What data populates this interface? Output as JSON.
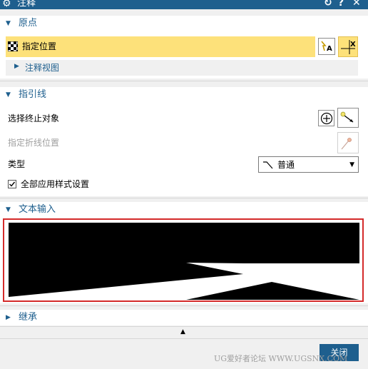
{
  "window": {
    "title": "注释"
  },
  "sections": {
    "origin": {
      "label": "原点",
      "specify_location": "指定位置",
      "annotation_view": "注释视图"
    },
    "leader": {
      "label": "指引线",
      "select_terminating_object": "选择终止对象",
      "specify_jog_location": "指定折线位置",
      "type_label": "类型",
      "type_value": "普通",
      "apply_all_style": "全部应用样式设置",
      "apply_all_checked": true
    },
    "text_input": {
      "label": "文本输入"
    },
    "inherit": {
      "label": "继承"
    }
  },
  "footer": {
    "close_label": "关闭",
    "watermark": "UG爱好者论坛 WWW.UGSNX.COM"
  },
  "colors": {
    "titlebar": "#1e5f8e",
    "highlight": "#fde17a",
    "accent_border": "#d42a2a"
  }
}
